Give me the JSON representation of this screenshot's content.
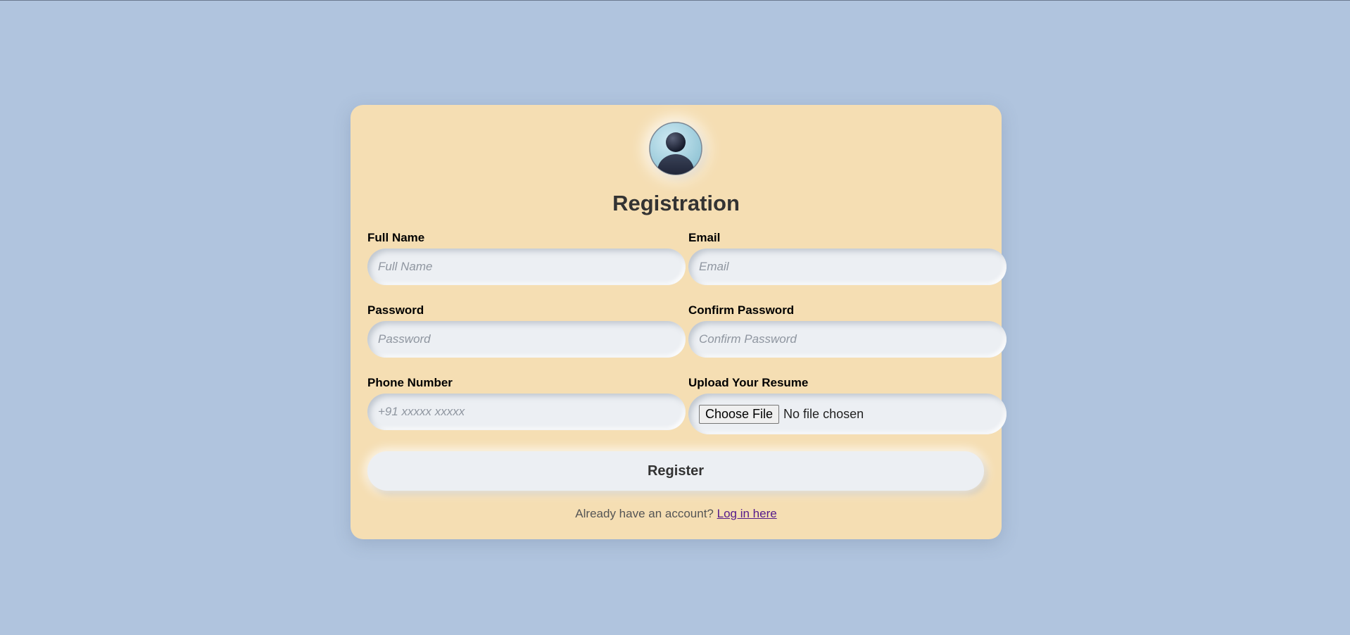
{
  "page": {
    "background": "#b0c4de",
    "card_color": "#f5deb3"
  },
  "header": {
    "avatar_icon": "user-avatar-icon",
    "title": "Registration"
  },
  "form": {
    "full_name": {
      "label": "Full Name",
      "placeholder": "Full Name",
      "value": ""
    },
    "email": {
      "label": "Email",
      "placeholder": "Email",
      "value": ""
    },
    "password": {
      "label": "Password",
      "placeholder": "Password",
      "value": ""
    },
    "confirm_password": {
      "label": "Confirm Password",
      "placeholder": "Confirm Password",
      "value": ""
    },
    "phone": {
      "label": "Phone Number",
      "placeholder": "+91 xxxxx xxxxx",
      "value": ""
    },
    "resume": {
      "label": "Upload Your Resume",
      "button_label": "Choose File",
      "status": "No file chosen"
    }
  },
  "actions": {
    "register_label": "Register"
  },
  "footer": {
    "text": "Already have an account?",
    "link_label": "Log in here"
  }
}
